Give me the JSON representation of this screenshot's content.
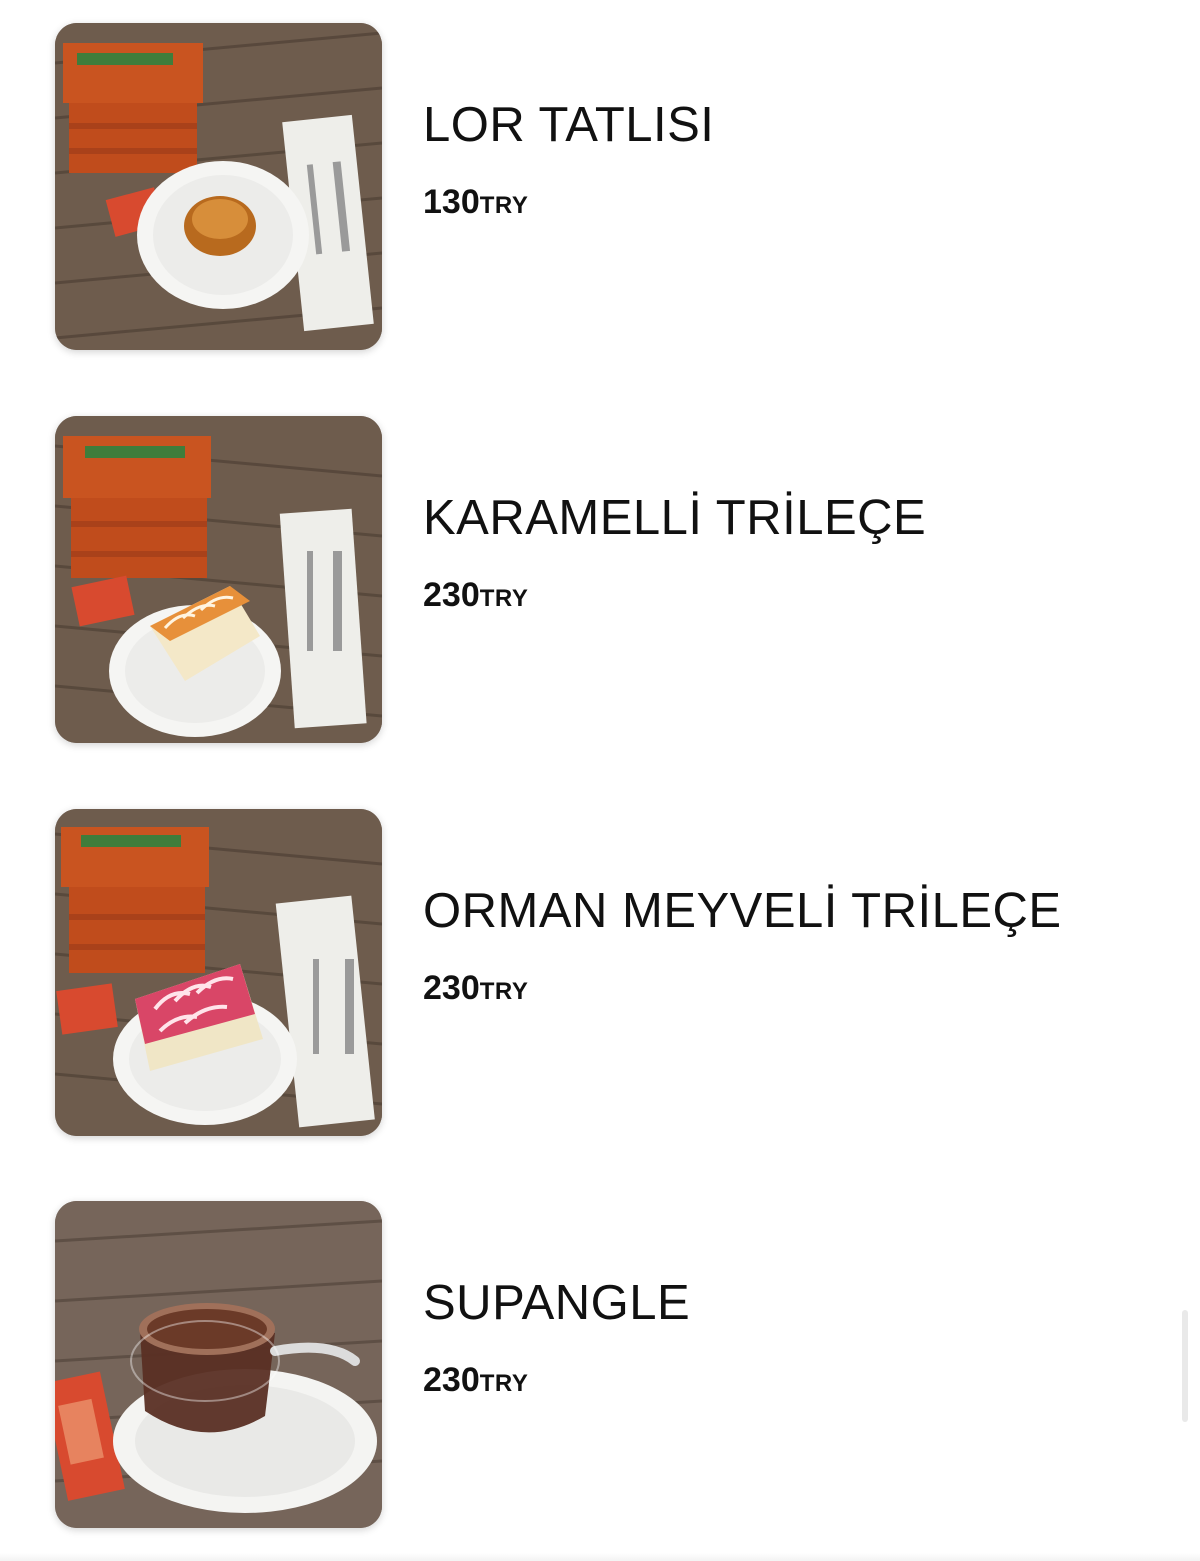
{
  "colors": {
    "text": "#111111",
    "background": "#ffffff",
    "box": "#c4521f",
    "table_wood": "#6b5a4c"
  },
  "menu": {
    "items": [
      {
        "name": "LOR TATLISI",
        "price": "130",
        "currency": "TRY",
        "image_icon": "lor-tatlisi-photo",
        "dessert": "round-cake"
      },
      {
        "name": "KARAMELLİ TRİLEÇE",
        "price": "230",
        "currency": "TRY",
        "image_icon": "karamelli-trilece-photo",
        "dessert": "caramel-slice"
      },
      {
        "name": "ORMAN MEYVELİ TRİLEÇE",
        "price": "230",
        "currency": "TRY",
        "image_icon": "orman-meyveli-trilece-photo",
        "dessert": "berry-slice"
      },
      {
        "name": "SUPANGLE",
        "price": "230",
        "currency": "TRY",
        "image_icon": "supangle-photo",
        "dessert": "chocolate-cup"
      }
    ]
  }
}
